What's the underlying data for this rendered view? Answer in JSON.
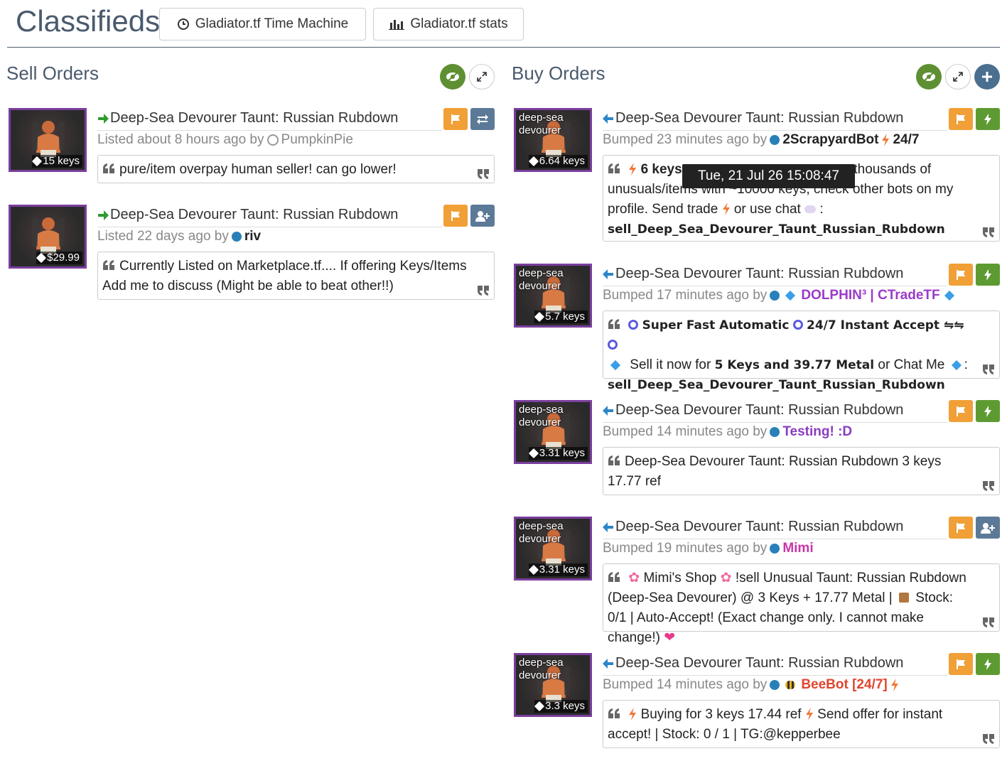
{
  "header": {
    "title": "Classifieds",
    "time_machine_label": "Gladiator.tf Time Machine",
    "stats_label": "Gladiator.tf stats"
  },
  "sell": {
    "title": "Sell Orders",
    "listings": [
      {
        "name": "Deep-Sea Devourer Taunt: Russian Rubdown",
        "price": "15 keys",
        "status_prefix": "Listed about 8 hours ago by",
        "user": "PumpkinPie",
        "user_indicator": "offline-ring",
        "note": "pure/item overpay human seller! can go lower!",
        "action": "trade-offer-icon"
      },
      {
        "name": "Deep-Sea Devourer Taunt: Russian Rubdown",
        "price": "$29.99",
        "status_prefix": "Listed 22 days ago by",
        "user": "riv",
        "user_indicator": "online-dot",
        "note": "Currently Listed on Marketplace.tf.... If offering Keys/Items Add me to discuss (Might be able to beat other!!)",
        "action": "add-friend-icon"
      }
    ]
  },
  "buy": {
    "title": "Buy Orders",
    "listings": [
      {
        "effect": "deep-sea devourer",
        "name": "Deep-Sea Devourer Taunt: Russian Rubdown",
        "price": "6.64 keys",
        "status_prefix": "Bumped 23 minutes ago by",
        "user": "2ScrapyardBot",
        "user_suffix": "24/7",
        "user_color": "#222222",
        "note_part1": "6 keys",
        "note_part2": "ng thousands of unusuals/items with ~10000 keys, check other bots on my profile. Send trade",
        "note_part3": "or use chat",
        "note_cmd": "sell_Deep_Sea_Devourer_Taunt_Russian_Rubdown",
        "tooltip": "Tue, 21 Jul 26 15:08:47 +0000",
        "action": "lightning-icon"
      },
      {
        "effect": "deep-sea devourer",
        "name": "Deep-Sea Devourer Taunt: Russian Rubdown",
        "price": "5.7 keys",
        "status_prefix": "Bumped 17 minutes ago by",
        "user": "DOLPHIN³ | CTradeTF",
        "user_color": "#9b3ac9",
        "note_bold1": "Super Fast Automatic",
        "note_bold2": "24/7 Instant Accept ⇋⇋",
        "note_text1": "Sell it now for",
        "note_bold3": "5 Keys and 39.77 Metal",
        "note_text2": "or Chat Me",
        "note_cmd": "sell_Deep_Sea_Devourer_Taunt_Russian_Rubdown",
        "action": "lightning-icon"
      },
      {
        "effect": "deep-sea devourer",
        "name": "Deep-Sea Devourer Taunt: Russian Rubdown",
        "price": "3.31 keys",
        "status_prefix": "Bumped 14 minutes ago by",
        "user": "Testing! :D",
        "user_color": "#8a3cc0",
        "note": "Deep-Sea Devourer Taunt: Russian Rubdown 3 keys 17.77 ref",
        "action": "lightning-icon"
      },
      {
        "effect": "deep-sea devourer",
        "name": "Deep-Sea Devourer Taunt: Russian Rubdown",
        "price": "3.31 keys",
        "status_prefix": "Bumped 19 minutes ago by",
        "user": "Mimi",
        "user_color": "#c837a8",
        "note_a": "Mimi's Shop",
        "note_b": "!sell Unusual Taunt: Russian Rubdown (Deep-Sea Devourer) @ 3 Keys + 17.77 Metal |",
        "note_c": "Stock: 0/1 | Auto-Accept! (Exact change only. I cannot make change!)",
        "action": "add-friend-icon"
      },
      {
        "effect": "deep-sea devourer",
        "name": "Deep-Sea Devourer Taunt: Russian Rubdown",
        "price": "3.3 keys",
        "status_prefix": "Bumped 14 minutes ago by",
        "user": "BeeBot [24/7]",
        "user_color": "#e0452e",
        "note_a": "Buying for 3 keys 17.44 ref",
        "note_b": "Send offer for instant accept! | Stock: 0 / 1 | TG:@kepperbee",
        "action": "lightning-icon"
      }
    ]
  },
  "colors": {
    "unusual_border": "#7a3e9d",
    "flag_button": "#f0a036",
    "instant_button": "#5e9a32",
    "friend_button": "#5c7a97",
    "sell_arrow": "#2e9b2e",
    "buy_arrow": "#2a86c8"
  }
}
